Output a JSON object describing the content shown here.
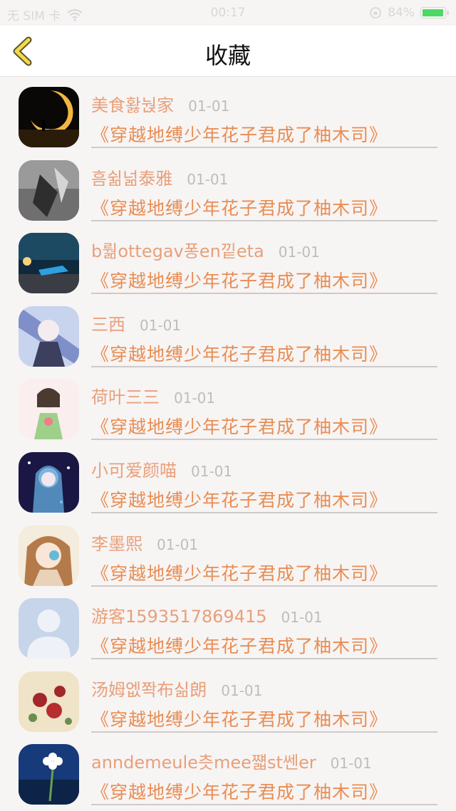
{
  "status_bar": {
    "carrier": "无 SIM 卡",
    "time": "00:17",
    "battery": "84%"
  },
  "nav": {
    "title": "收藏"
  },
  "items": [
    {
      "name": "美食홣눥家",
      "date": "01-01",
      "title": "《穿越地缚少年花子君成了柚木司》"
    },
    {
      "name": "흠쉶넒泰雅",
      "date": "01-01",
      "title": "《穿越地缚少年花子君成了柚木司》"
    },
    {
      "name": "b뤎ottegav퐁en낕eta",
      "date": "01-01",
      "title": "《穿越地缚少年花子君成了柚木司》"
    },
    {
      "name": "三西",
      "date": "01-01",
      "title": "《穿越地缚少年花子君成了柚木司》"
    },
    {
      "name": "荷叶三三",
      "date": "01-01",
      "title": "《穿越地缚少年花子君成了柚木司》"
    },
    {
      "name": "小可爱颜喵",
      "date": "01-01",
      "title": "《穿越地缚少年花子君成了柚木司》"
    },
    {
      "name": "李墨熙",
      "date": "01-01",
      "title": "《穿越地缚少年花子君成了柚木司》"
    },
    {
      "name": "游客1593517869415",
      "date": "01-01",
      "title": "《穿越地缚少年花子君成了柚木司》"
    },
    {
      "name": "汤姆엢쫙布싦朗",
      "date": "01-01",
      "title": "《穿越地缚少年花子君成了柚木司》"
    },
    {
      "name": "anndemeule츳mee쨻st쎈er",
      "date": "01-01",
      "title": "《穿越地缚少年花子君成了柚木司》"
    }
  ]
}
